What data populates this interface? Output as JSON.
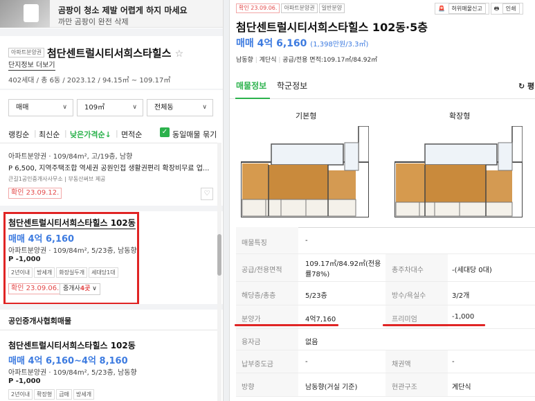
{
  "ad": {
    "title": "곰팡이 청소 제발 어렵게 하지 마세요",
    "subtitle": "까만 곰팡이 완전 삭제"
  },
  "complex": {
    "tag": "아파트분양권",
    "name": "첨단센트럴시티서희스타힐스",
    "star": "☆",
    "more_link": "단지정보 더보기",
    "info": "402세대 / 총 6동 / 2023.12 / 94.15㎡ ~ 109.17㎡"
  },
  "filters": {
    "trade": "매매",
    "area": "109㎡",
    "building": "전체동"
  },
  "sort": {
    "ranking": "랭킹순",
    "latest": "최신순",
    "low_price": "낮은가격순↓",
    "area": "면적순",
    "same_listing": "동일매물 묶기"
  },
  "listings": [
    {
      "sub": "아파트분양권 · 109/84m², 고/19층, 남향",
      "desc": "P 6,500, 지역주택조합 역세권 공원인접 생활권편리 확장비무료 업...",
      "agent": "큰길1공인중개사사무소 | 부동산써브 제공",
      "confirm": "확인 23.09.12."
    },
    {
      "name": "첨단센트럴시티서희스타힐스 102동",
      "price": "매매 4억 6,160",
      "sub": "아파트분양권 · 109/84m², 5/23층, 남동향",
      "desc": "P -1,000",
      "chips": [
        "2년이내",
        "방세개",
        "화장실두개",
        "세대당1대"
      ],
      "confirm": "확인 23.09.06.",
      "agent_btn_prefix": "중개사",
      "agent_btn_count": "4곳"
    },
    {
      "name": "첨단센트럴시티서희스타힐스 102동",
      "price": "매매 4억 6,160~4억 8,160",
      "sub": "아파트분양권 · 109/84m², 5/23층, 남동향",
      "desc": "P -1,000",
      "chips": [
        "2년이내",
        "확장형",
        "급매",
        "방세개"
      ]
    }
  ],
  "section_title": "공인중개사협회매물",
  "detail": {
    "tags": [
      "확인 23.09.06.",
      "아파트분양권",
      "일반분양"
    ],
    "report": "허위매물신고",
    "print": "인쇄",
    "title": "첨단센트럴시티서희스타힐스 102동·5층",
    "price": "매매 4억 6,160",
    "price_unit": "(1,398만원/3.3㎡)",
    "meta": [
      "남동향",
      "계단식",
      "공급/전용 면적:109.17㎡/84.92㎡"
    ],
    "tabs": [
      "매물정보",
      "학군정보"
    ],
    "refresh": "↻ 평",
    "plan_labels": [
      "기본형",
      "확장형"
    ],
    "rows": [
      {
        "k": "매물특징",
        "v": "-"
      },
      {
        "k": "공급/전용면적",
        "v": "109.17㎡/84.92㎡(전용",
        "v_line2": "률78%)",
        "k2": "총주차대수",
        "v2": "-(세대당 0대)"
      },
      {
        "k": "해당층/총층",
        "v": "5/23층",
        "k2": "방수/욕실수",
        "v2": "3/2개"
      },
      {
        "k": "분양가",
        "v": "4억7,160",
        "k2": "프리미엄",
        "v2": "-1,000"
      },
      {
        "k": "융자금",
        "v": "없음"
      },
      {
        "k": "납부중도금",
        "v": "-",
        "k2": "채권액",
        "v2": "-"
      },
      {
        "k": "방향",
        "v": "남동향(거실 기준)",
        "k2": "현관구조",
        "v2": "계단식"
      }
    ]
  },
  "colors": {
    "accent_green": "#2bb24c",
    "price_blue": "#3d7be0",
    "alert_red": "#e02424"
  }
}
